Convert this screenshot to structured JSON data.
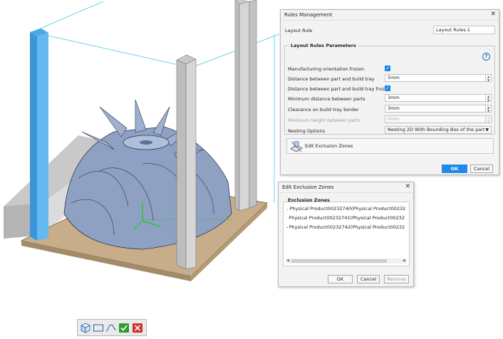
{
  "rules_dialog": {
    "title": "Rules Management",
    "layout_rule_label": "Layout Rule",
    "layout_rule_value": "Layout Rules.1",
    "params_title": "Layout Rules Parameters",
    "help_glyph": "?",
    "params": [
      {
        "label": "Manufacturing orientation frozen"
      },
      {
        "label": "Distance between part and build tray",
        "value": "5mm"
      },
      {
        "label": "Distance between part and build tray frozen"
      },
      {
        "label": "Minimum distance between parts",
        "value": "3mm"
      },
      {
        "label": "Clearance on build tray border",
        "value": "3mm"
      },
      {
        "label": "Minimum height between parts",
        "value": "0mm"
      },
      {
        "label": "Nesting Options",
        "value": "Nesting 2D With Bounding Box of the part"
      }
    ],
    "edit_zones_label": "Edit Exclusion Zones",
    "ok_label": "OK",
    "cancel_label": "Cancel"
  },
  "zones_dialog": {
    "title": "Edit Exclusion Zones",
    "group_title": "Exclusion Zones",
    "items": [
      "Physical Product00232740(Physical Product00232",
      "Physical Product00232741(Physical Product00232",
      "Physical Product00232742(Physical Product00232"
    ],
    "ok_label": "OK",
    "cancel_label": "Cancel",
    "remove_label": "Remove"
  },
  "toolbar": {
    "icons": [
      "bounding-box-icon",
      "rectangle-icon",
      "freeform-curve-icon",
      "validate-icon",
      "cancel-icon"
    ]
  },
  "colors": {
    "accent": "#1f8ae8",
    "tray": "#c7ad8a",
    "part": "#8ea1c3",
    "selection": "#6fd4e8"
  }
}
